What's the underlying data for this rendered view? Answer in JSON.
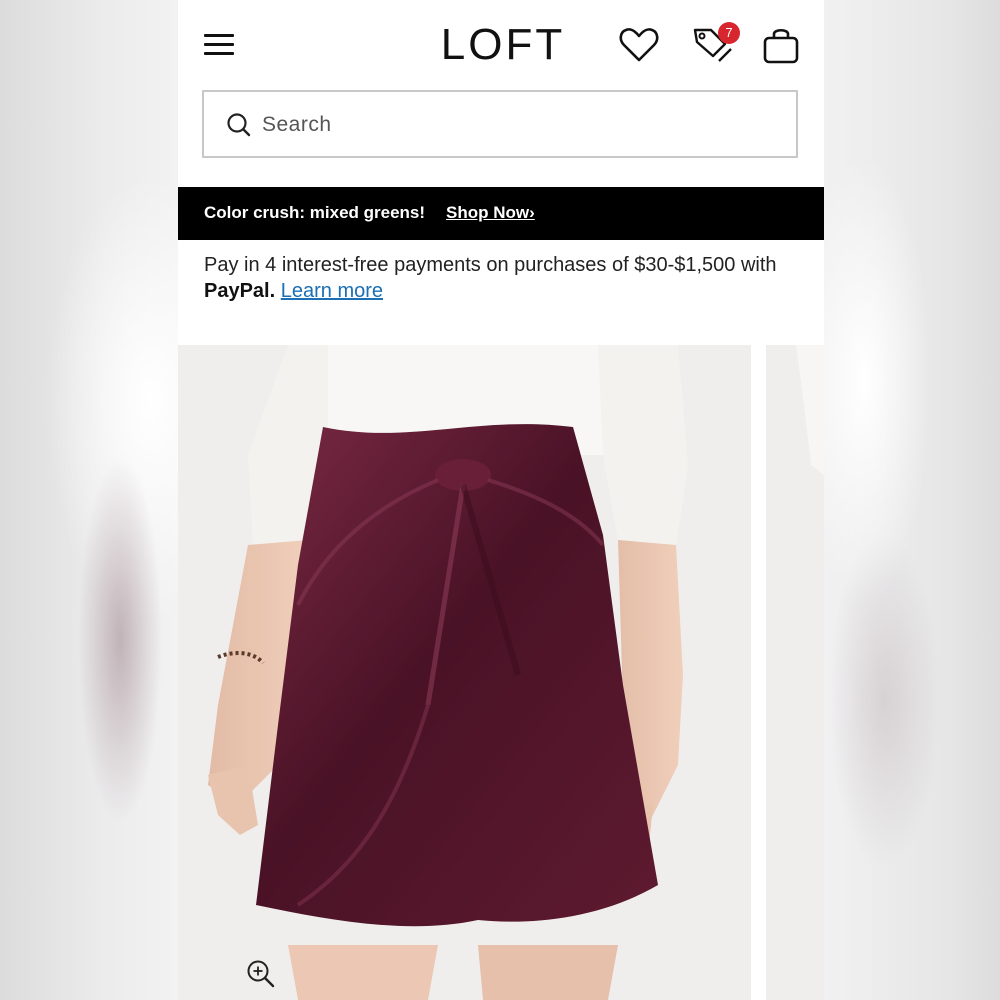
{
  "header": {
    "logo": "LOFT",
    "menu_icon": "hamburger-menu-icon",
    "favorites_icon": "heart-icon",
    "offers_icon": "price-tags-icon",
    "offers_badge_count": "7",
    "bag_icon": "shopping-bag-icon"
  },
  "search": {
    "placeholder": "Search",
    "icon": "search-icon"
  },
  "promo_banner": {
    "text": "Color crush: mixed greens!",
    "link_label": "Shop Now›"
  },
  "paypal_message": {
    "text": "Pay in 4 interest-free payments on purchases of $30-$1,500 with",
    "brand": "PayPal.",
    "link_label": "Learn more"
  },
  "product_gallery": {
    "zoom_icon": "zoom-in-icon"
  },
  "colors": {
    "badge": "#d8262e",
    "promo_background": "#000000",
    "link": "#1a6fb5",
    "skirt": "#5a1a2e"
  }
}
